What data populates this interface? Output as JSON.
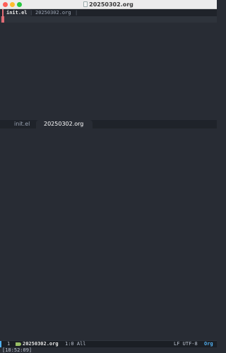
{
  "window": {
    "title": "20250302.org",
    "controls": [
      "close",
      "minimize",
      "maximize"
    ]
  },
  "tabline": {
    "active_tab": "init.el",
    "separator": "|",
    "inactive_tab": "20250302.org",
    "trailing_separator": "|"
  },
  "editor": {
    "cursor_line": 1,
    "cursor_color": "#e06c75"
  },
  "window_tabs": {
    "tabs": [
      {
        "label": "init.el",
        "active": false
      },
      {
        "label": "20250302.org",
        "active": true
      }
    ]
  },
  "modeline": {
    "window_number": "1",
    "file_icon": "org-unicorn-icon",
    "filename": "20250302.org",
    "position": "1:0 All",
    "encoding": "LF UTF-8",
    "major_mode": "Org",
    "accent_color": "#51afef"
  },
  "echo_area": {
    "text": "[18:52:09]"
  },
  "colors": {
    "background": "#282c34",
    "tabline_bg": "#1f232a",
    "modeline_bg": "#1b1f25"
  }
}
